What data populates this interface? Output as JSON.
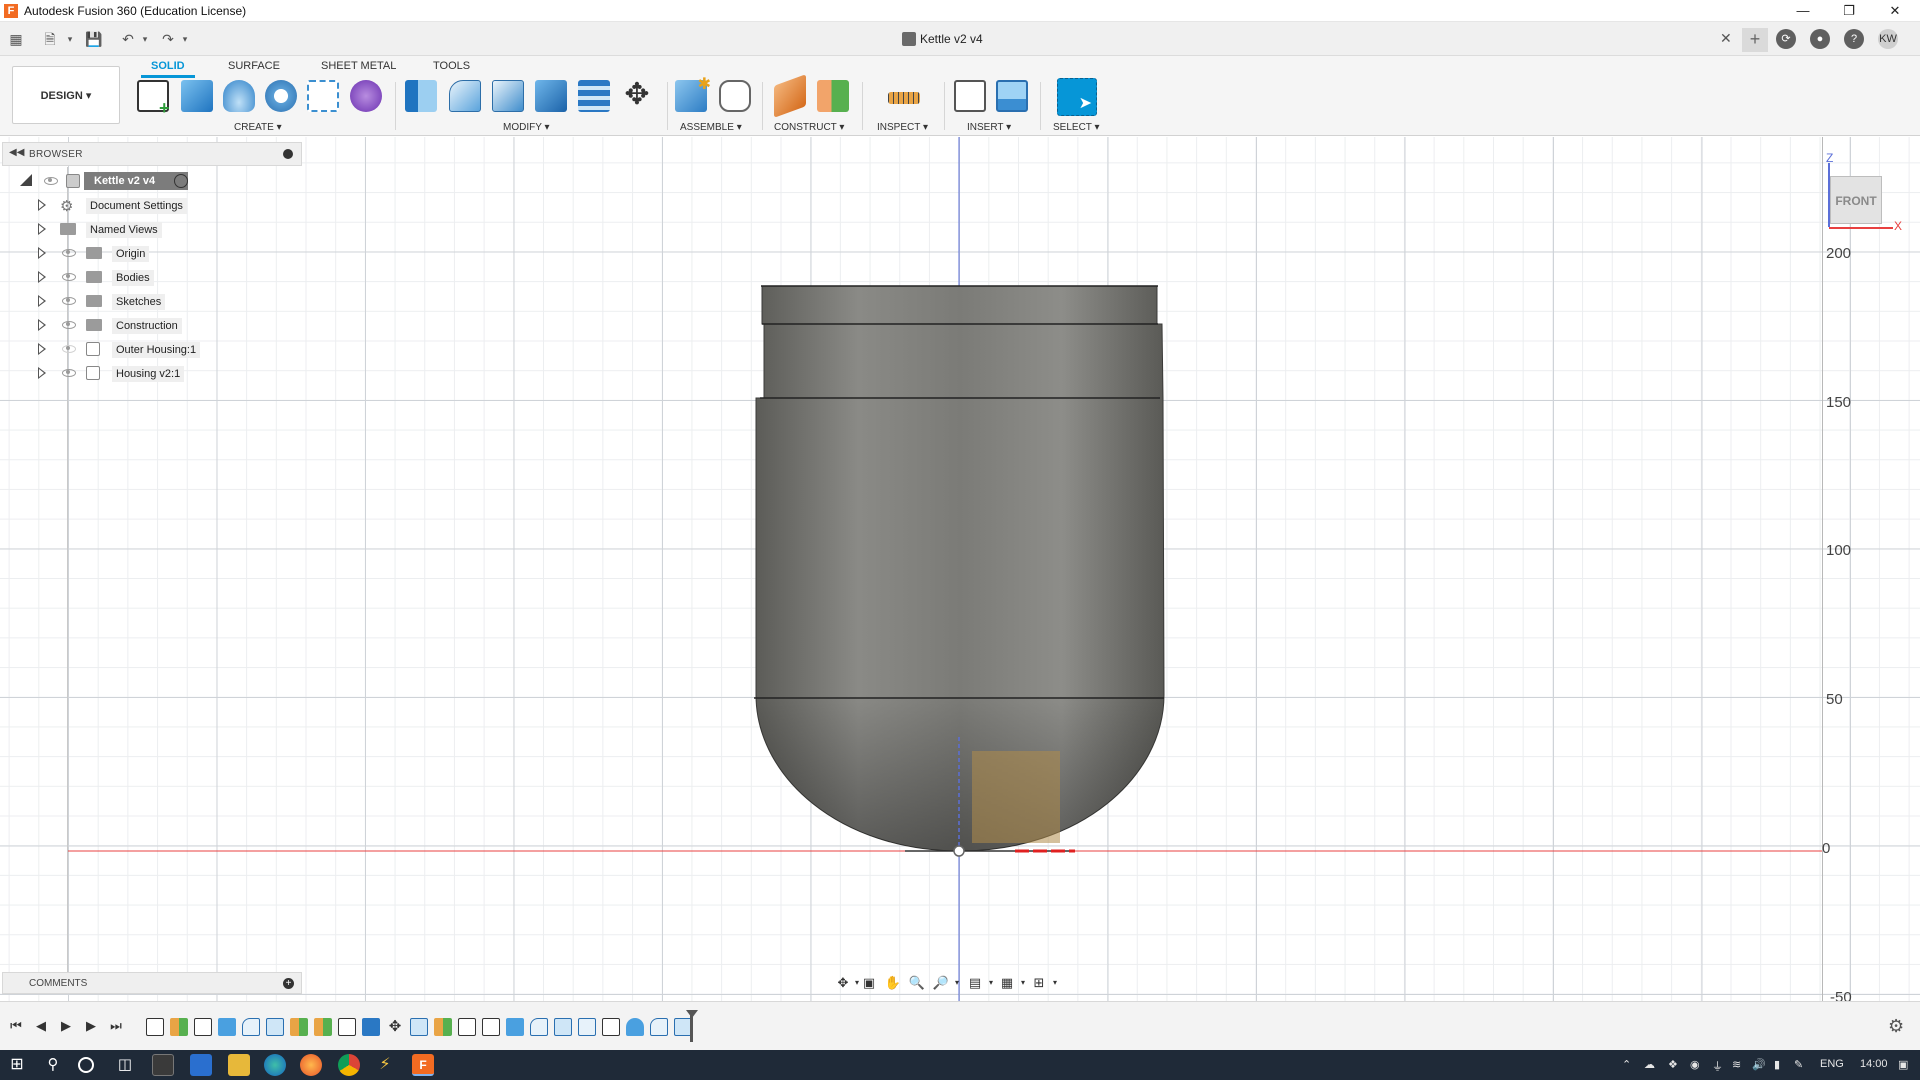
{
  "window": {
    "title": "Autodesk Fusion 360 (Education License)",
    "app_icon": "F"
  },
  "document_tab": {
    "title": "Kettle v2 v4",
    "user_initials": "KW"
  },
  "workspace": {
    "label": "DESIGN"
  },
  "ribbon": {
    "tabs": [
      "SOLID",
      "SURFACE",
      "SHEET METAL",
      "TOOLS"
    ],
    "active_tab": "SOLID",
    "groups": [
      "CREATE",
      "MODIFY",
      "ASSEMBLE",
      "CONSTRUCT",
      "INSPECT",
      "INSERT",
      "SELECT"
    ]
  },
  "browser": {
    "title": "BROWSER",
    "root": "Kettle v2 v4",
    "items": [
      "Document Settings",
      "Named Views",
      "Origin",
      "Bodies",
      "Sketches",
      "Construction",
      "Outer Housing:1",
      "Housing v2:1"
    ]
  },
  "comments": {
    "title": "COMMENTS"
  },
  "viewcube": {
    "face": "FRONT",
    "axis_z": "Z",
    "axis_x": "X"
  },
  "ruler": {
    "ticks": [
      "200",
      "150",
      "100",
      "50",
      "0",
      "-50"
    ]
  },
  "taskbar": {
    "lang": "ENG",
    "time": "14:00"
  },
  "colors": {
    "accent": "#0696d7",
    "body": "#7a7a76",
    "sketch_profile": "#b08d4a",
    "x_axis": "#e84040",
    "z_axis": "#5b6fd8"
  }
}
